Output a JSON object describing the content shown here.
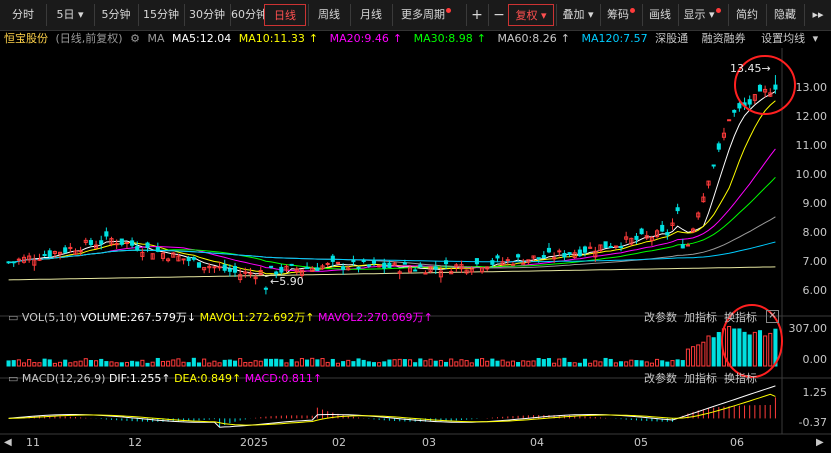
{
  "toolbar": {
    "periods": [
      "分时",
      "5日",
      "5分钟",
      "15分钟",
      "30分钟",
      "60分钟",
      "日线",
      "周线",
      "月线",
      "更多周期"
    ],
    "active_period": "日线",
    "plus": "+",
    "minus": "−",
    "fuquan": "复权",
    "overlay": "叠加",
    "chips": "筹码",
    "draw": "画线",
    "display": "显示",
    "simple": "简约",
    "hide": "隐藏",
    "more": "▸▸"
  },
  "info": {
    "stock_name": "恒宝股份",
    "mode": "(日线,前复权)",
    "ma_label": "MA",
    "ma5": "MA5:12.04",
    "ma10": "MA10:11.33",
    "ma20": "MA20:9.46",
    "ma30": "MA30:8.98",
    "ma60": "MA60:8.26",
    "ma120": "MA120:7.57",
    "link1": "深股通",
    "link2": "融资融券",
    "ma_settings": "设置均线"
  },
  "price_panel": {
    "y_ticks": [
      "13.00",
      "12.00",
      "11.00",
      "10.00",
      "9.00",
      "8.00",
      "7.00",
      "6.00"
    ],
    "high_label": "13.45",
    "low_label": "5.90"
  },
  "volume_panel": {
    "title": "VOL(5,10)",
    "volume": "VOLUME:267.579万",
    "mavol1": "MAVOL1:272.692万",
    "mavol2": "MAVOL2:270.069万",
    "btn_params": "改参数",
    "btn_add": "加指标",
    "btn_switch": "换指标",
    "y_ticks": [
      "307.00",
      "0.00"
    ]
  },
  "macd_panel": {
    "title": "MACD(12,26,9)",
    "dif": "DIF:1.255",
    "dea": "DEA:0.849",
    "macd": "MACD:0.811",
    "btn_params": "改参数",
    "btn_add": "加指标",
    "btn_switch": "换指标",
    "y_ticks": [
      "1.25",
      "-0.37"
    ]
  },
  "x_axis": {
    "labels": [
      "11",
      "12",
      "2025",
      "02",
      "03",
      "04",
      "05",
      "06"
    ]
  },
  "colors": {
    "up": "#ff3b3b",
    "down": "#00e0e0",
    "ma5": "#ffffff",
    "ma10": "#ffff00",
    "ma20": "#ff00ff",
    "ma30": "#00ff00",
    "ma60": "#9a9a9a",
    "ma120": "#00ccff",
    "annotation_circle": "#ff2020"
  },
  "chart_data": {
    "type": "candlestick",
    "price_range": [
      5.5,
      13.9
    ],
    "key_points": [
      {
        "label": "11",
        "price": 7.0
      },
      {
        "label": "12",
        "price": 7.8
      },
      {
        "label": "2025",
        "price": 6.6
      },
      {
        "label": "02",
        "price": 6.9
      },
      {
        "label": "03",
        "price": 6.8
      },
      {
        "label": "04",
        "price": 7.2
      },
      {
        "label": "05",
        "price": 8.0
      },
      {
        "label": "06",
        "price": 12.0
      }
    ],
    "ma_last": {
      "MA5": 12.04,
      "MA10": 11.33,
      "MA20": 9.46,
      "MA30": 8.98,
      "MA60": 8.26,
      "MA120": 7.57
    },
    "high": 13.45,
    "low": 5.9,
    "volume_last": 267.579,
    "mavol1_last": 272.692,
    "mavol2_last": 270.069,
    "volume_max": 307.0,
    "dif": 1.255,
    "dea": 0.849,
    "macd": 0.811,
    "macd_range": [
      -0.37,
      1.25
    ]
  }
}
